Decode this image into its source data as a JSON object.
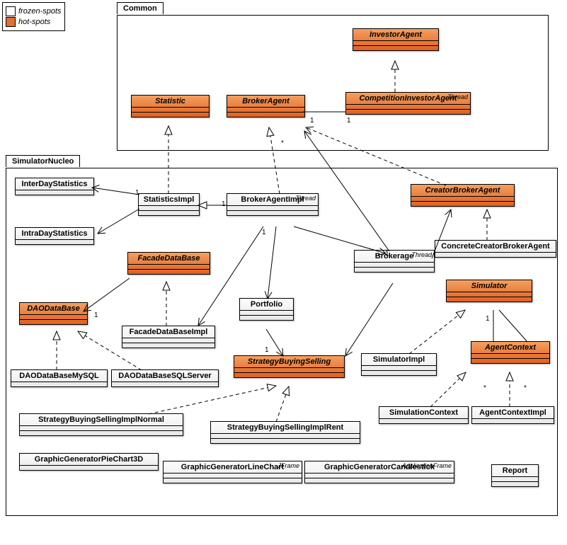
{
  "legend": {
    "frozen": "frozen-spots",
    "hot": "hot-spots"
  },
  "packages": {
    "common": "Common",
    "nucleo": "SimulatorNucleo"
  },
  "classes": {
    "investorAgent": {
      "name": "InvestorAgent",
      "hot": true
    },
    "statistic": {
      "name": "Statistic",
      "hot": true
    },
    "brokerAgent": {
      "name": "BrokerAgent",
      "hot": true
    },
    "competitionInvestorAgent": {
      "name": "CompetitionInvestorAgent",
      "hot": true,
      "stereo": "Thread"
    },
    "interDayStatistics": {
      "name": "InterDayStatistics",
      "hot": false
    },
    "statisticsImpl": {
      "name": "StatisticsImpl",
      "hot": false
    },
    "brokerAgentImpl": {
      "name": "BrokerAgentImpl",
      "hot": false,
      "stereo": "Thread"
    },
    "creatorBrokerAgent": {
      "name": "CreatorBrokerAgent",
      "hot": true
    },
    "intraDayStatistics": {
      "name": "IntraDayStatistics",
      "hot": false
    },
    "facadeDataBase": {
      "name": "FacadeDataBase",
      "hot": true
    },
    "brokerage": {
      "name": "Brokerage",
      "hot": false,
      "stereo": "Thread"
    },
    "concreteCreatorBrokerAgent": {
      "name": "ConcreteCreatorBrokerAgent",
      "hot": false
    },
    "daoDataBase": {
      "name": "DAODataBase",
      "hot": true
    },
    "facadeDataBaseImpl": {
      "name": "FacadeDataBaseImpl",
      "hot": false
    },
    "portfolio": {
      "name": "Portfolio",
      "hot": false
    },
    "simulator": {
      "name": "Simulator",
      "hot": true
    },
    "daoDataBaseMySQL": {
      "name": "DAODataBaseMySQL",
      "hot": false
    },
    "daoDataBaseSQLServer": {
      "name": "DAODataBaseSQLServer",
      "hot": false
    },
    "strategyBuyingSelling": {
      "name": "StrategyBuyingSelling",
      "hot": true
    },
    "simulatorImpl": {
      "name": "SimulatorImpl",
      "hot": false
    },
    "agentContext": {
      "name": "AgentContext",
      "hot": true
    },
    "strategyBuyingSellingImplNormal": {
      "name": "StrategyBuyingSellingImplNormal",
      "hot": false
    },
    "strategyBuyingSellingImplRent": {
      "name": "StrategyBuyingSellingImplRent",
      "hot": false
    },
    "simulationContext": {
      "name": "SimulationContext",
      "hot": false
    },
    "agentContextImpl": {
      "name": "AgentContextImpl",
      "hot": false
    },
    "graphicGeneratorPieChart3D": {
      "name": "GraphicGeneratorPieChart3D",
      "hot": false
    },
    "graphicGeneratorLineChart": {
      "name": "GraphicGeneratorLineChart",
      "hot": false,
      "stereo": "JFrame"
    },
    "graphicGeneratorCandlestick": {
      "name": "GraphicGeneratorCandlestick",
      "hot": false,
      "stereo": "ApplicationFrame"
    },
    "report": {
      "name": "Report",
      "hot": false
    }
  },
  "mults": {
    "one": "1",
    "many": "*"
  }
}
